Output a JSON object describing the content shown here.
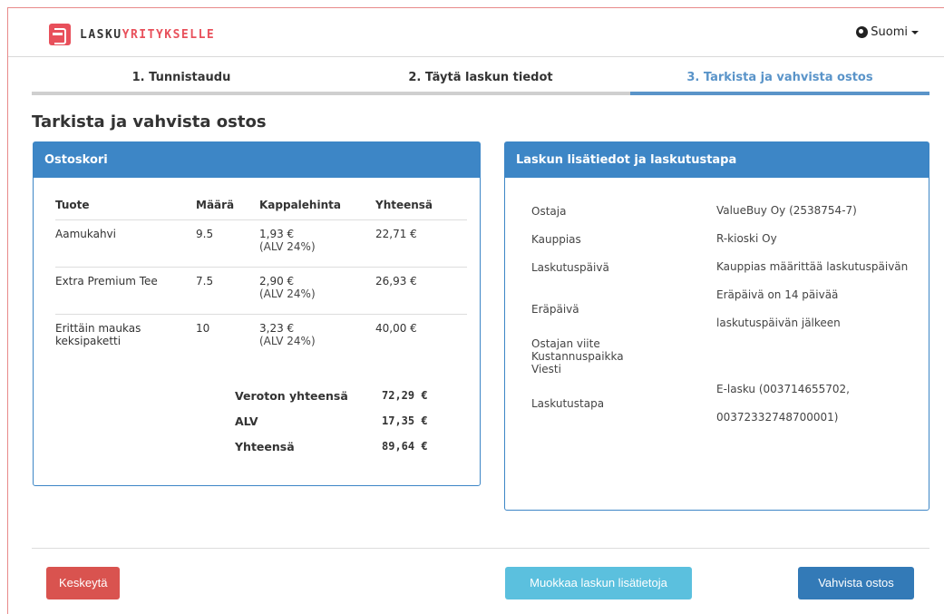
{
  "header": {
    "logo_part1": "LASKU",
    "logo_part2": "YRITYKSELLE",
    "language": "Suomi"
  },
  "steps": [
    {
      "label": "1. Tunnistaudu"
    },
    {
      "label": "2. Täytä laskun tiedot"
    },
    {
      "label": "3. Tarkista ja vahvista ostos"
    }
  ],
  "page_title": "Tarkista ja vahvista ostos",
  "cart": {
    "title": "Ostoskori",
    "columns": [
      "Tuote",
      "Määrä",
      "Kappalehinta",
      "Yhteensä"
    ],
    "rows": [
      {
        "product": "Aamukahvi",
        "qty": "9.5",
        "price": "1,93 €",
        "vat": "(ALV 24%)",
        "total": "22,71 €"
      },
      {
        "product": "Extra Premium Tee",
        "qty": "7.5",
        "price": "2,90 €",
        "vat": "(ALV 24%)",
        "total": "26,93 €"
      },
      {
        "product": "Erittäin maukas keksipaketti",
        "qty": "10",
        "price": "3,23 €",
        "vat": "(ALV 24%)",
        "total": "40,00 €"
      }
    ],
    "totals": [
      {
        "label": "Veroton yhteensä",
        "value": "72,29 €"
      },
      {
        "label": "ALV",
        "value": "17,35 €"
      },
      {
        "label": "Yhteensä",
        "value": "89,64 €"
      }
    ]
  },
  "details": {
    "title": "Laskun lisätiedot ja laskutustapa",
    "rows": [
      {
        "label": "Ostaja",
        "value": "ValueBuy Oy (2538754-7)"
      },
      {
        "label": "Kauppias",
        "value": "R-kioski Oy"
      },
      {
        "label": "Laskutuspäivä",
        "value": "Kauppias määrittää laskutuspäivän"
      },
      {
        "label": "Eräpäivä",
        "value": "Eräpäivä on 14 päivää laskutuspäivän jälkeen"
      },
      {
        "label": "Ostajan viite",
        "value": ""
      },
      {
        "label": "Kustannuspaikka",
        "value": ""
      },
      {
        "label": "Viesti",
        "value": ""
      },
      {
        "label": "Laskutustapa",
        "value": "E-lasku (003714655702, 00372332748700001)"
      }
    ]
  },
  "buttons": {
    "cancel": "Keskeytä",
    "edit": "Muokkaa laskun lisätietoja",
    "confirm": "Vahvista ostos"
  },
  "colors": {
    "brand": "#e8505b",
    "primary": "#3d86c6",
    "danger": "#d9534f",
    "info": "#5bc0de",
    "confirm": "#337ab7"
  }
}
